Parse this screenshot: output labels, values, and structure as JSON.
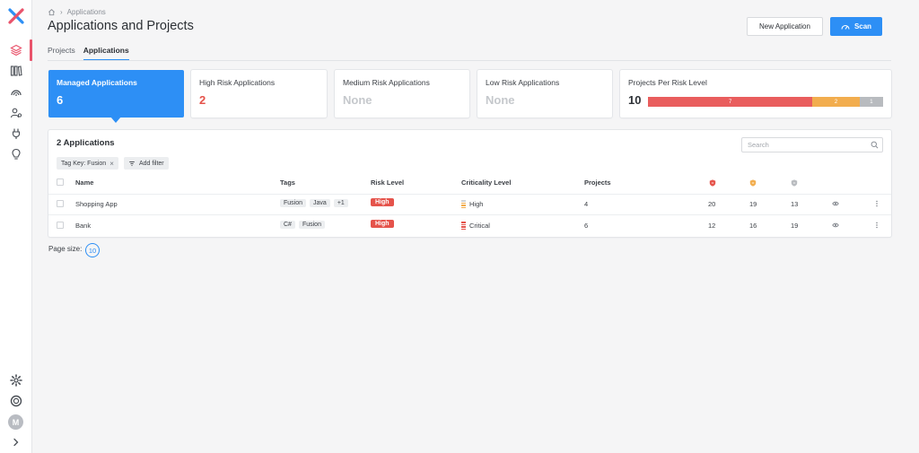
{
  "breadcrumb": {
    "current": "Applications"
  },
  "header": {
    "title": "Applications and Projects",
    "new_button": "New Application",
    "scan_button": "Scan"
  },
  "tabs": [
    {
      "label": "Projects",
      "active": false
    },
    {
      "label": "Applications",
      "active": true
    }
  ],
  "cards": {
    "managed": {
      "label": "Managed Applications",
      "value": "6"
    },
    "high": {
      "label": "High Risk Applications",
      "value": "2"
    },
    "medium": {
      "label": "Medium Risk Applications",
      "value": "None"
    },
    "low": {
      "label": "Low Risk Applications",
      "value": "None"
    },
    "projects": {
      "label": "Projects Per Risk Level",
      "value": "10",
      "segments": [
        {
          "level": "high",
          "count": 7,
          "label": "7",
          "color": "#e95d5d"
        },
        {
          "level": "medium",
          "count": 2,
          "label": "2",
          "color": "#f2ad4e"
        },
        {
          "level": "low",
          "count": 1,
          "label": "1",
          "color": "#b8bbbf"
        }
      ]
    }
  },
  "table": {
    "count_label": "2 Applications",
    "search_placeholder": "Search",
    "filter_chip": "Tag Key: Fusion",
    "add_filter": "Add filter",
    "columns": {
      "name": "Name",
      "tags": "Tags",
      "risk": "Risk Level",
      "criticality": "Criticality Level",
      "projects": "Projects"
    },
    "rows": [
      {
        "name": "Shopping App",
        "tags": [
          "Fusion",
          "Java",
          "+1"
        ],
        "risk": "High",
        "criticality": "High",
        "crit_level": 3,
        "projects": "4",
        "high": "20",
        "medium": "19",
        "low": "13"
      },
      {
        "name": "Bank",
        "tags": [
          "C#",
          "Fusion"
        ],
        "risk": "High",
        "criticality": "Critical",
        "crit_level": 4,
        "projects": "6",
        "high": "12",
        "medium": "16",
        "low": "19"
      }
    ]
  },
  "pagination": {
    "label": "Page size:",
    "size": "10"
  },
  "user": {
    "initial": "M"
  },
  "colors": {
    "accent": "#2d8ff5",
    "danger": "#e5534b",
    "warning": "#f2ad4e",
    "brand_pink": "#e9536b",
    "brand_blue": "#2d8ff5"
  }
}
